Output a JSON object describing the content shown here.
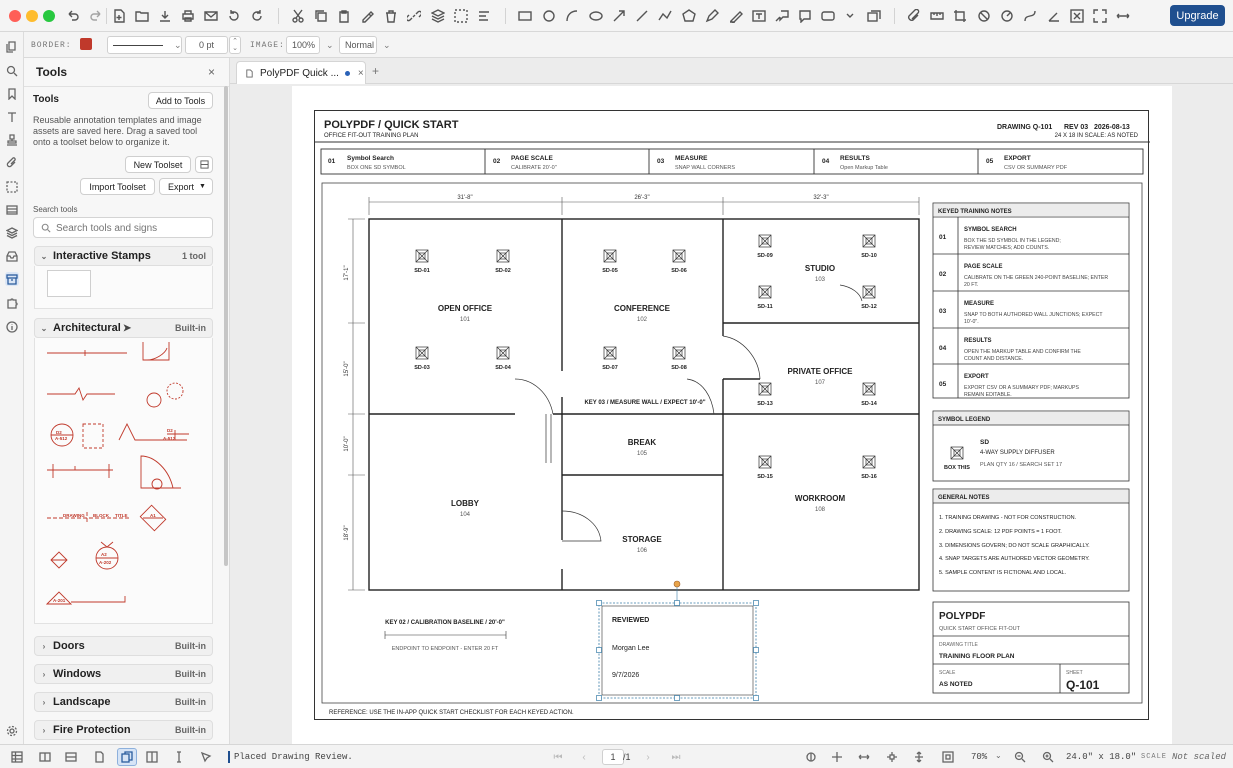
{
  "toolbar": {
    "upgrade": "Upgrade"
  },
  "props": {
    "border_label": "BORDER:",
    "border_color": "#c0392b",
    "width_value": "0 pt",
    "image_label": "IMAGE:",
    "image_zoom": "100%",
    "blend": "Normal"
  },
  "panel": {
    "header": "Tools",
    "close": "×",
    "section_title": "Tools",
    "add_to_tools": "Add to Tools",
    "description": "Reusable annotation templates and image assets are saved here. Drag a saved tool onto a toolset below to organize it.",
    "new_toolset": "New Toolset",
    "import_toolset": "Import Toolset",
    "export": "Export",
    "search_label": "Search tools",
    "search_placeholder": "Search tools and signs",
    "sections": [
      {
        "name": "Interactive Stamps",
        "tag": "1 tool"
      },
      {
        "name": "Architectural",
        "tag": "Built-in"
      },
      {
        "name": "Doors",
        "tag": "Built-in"
      },
      {
        "name": "Windows",
        "tag": "Built-in"
      },
      {
        "name": "Landscape",
        "tag": "Built-in"
      },
      {
        "name": "Fire Protection",
        "tag": "Built-in"
      }
    ],
    "arch_labels": {
      "a": "A-512",
      "b": "D2",
      "c": "A-512",
      "d": "D2",
      "e": "DRAWING",
      "f": "BLOCK",
      "g": "TITLE",
      "h": "A1",
      "i": "A-201",
      "j": "A2",
      "k": "A-202",
      "l": "A-201"
    }
  },
  "tabs": {
    "doc": "PolyPDF Quick ...",
    "add": "+"
  },
  "drawing": {
    "title": "POLYPDF / QUICK START",
    "subtitle": "OFFICE FIT-OUT TRAINING PLAN",
    "drawing_no": "DRAWING Q-101",
    "rev": "REV 03",
    "date": "2026-08-13",
    "size_scale": "24 X 18 IN    SCALE: AS NOTED",
    "steps": [
      {
        "num": "01",
        "title": "Symbol Search",
        "sub": "BOX ONE SD SYMBOL"
      },
      {
        "num": "02",
        "title": "PAGE SCALE",
        "sub": "CALIBRATE 20'-0\""
      },
      {
        "num": "03",
        "title": "MEASURE",
        "sub": "SNAP WALL CORNERS"
      },
      {
        "num": "04",
        "title": "RESULTS",
        "sub": "Open Markup Table"
      },
      {
        "num": "05",
        "title": "EXPORT",
        "sub": "CSV OR SUMMARY PDF"
      }
    ],
    "dims": {
      "d1": "31'-8\"",
      "d2": "26'-3\"",
      "d3": "32'-3\"",
      "v1": "17'-1\"",
      "v2": "15'-0\"",
      "v3": "10'-0\"",
      "v4": "18'-9\""
    },
    "rooms": [
      {
        "name": "OPEN OFFICE",
        "num": "101"
      },
      {
        "name": "CONFERENCE",
        "num": "102"
      },
      {
        "name": "STUDIO",
        "num": "103"
      },
      {
        "name": "LOBBY",
        "num": "104"
      },
      {
        "name": "BREAK",
        "num": "105"
      },
      {
        "name": "STORAGE",
        "num": "106"
      },
      {
        "name": "PRIVATE OFFICE",
        "num": "107"
      },
      {
        "name": "WORKROOM",
        "num": "108"
      }
    ],
    "sd": [
      "SD-01",
      "SD-02",
      "SD-03",
      "SD-04",
      "SD-05",
      "SD-06",
      "SD-07",
      "SD-08",
      "SD-09",
      "SD-10",
      "SD-11",
      "SD-12",
      "SD-13",
      "SD-14",
      "SD-15",
      "SD-16"
    ],
    "key03": "KEY 03 / MEASURE WALL / EXPECT 10'-0\"",
    "key02": "KEY 02 / CALIBRATION BASELINE / 20'-0\"",
    "key02_sub": "ENDPOINT TO ENDPOINT - ENTER 20 FT",
    "review": {
      "title": "REVIEWED",
      "name": "Morgan Lee",
      "date": "9/7/2026"
    },
    "notes_title": "KEYED TRAINING NOTES",
    "notes": [
      {
        "num": "01",
        "title": "SYMBOL SEARCH",
        "text1": "BOX THE SD SYMBOL IN THE LEGEND;",
        "text2": "REVIEW MATCHES; ADD COUNTS."
      },
      {
        "num": "02",
        "title": "PAGE SCALE",
        "text1": "CALIBRATE ON THE GREEN 240-POINT BASELINE; ENTER",
        "text2": "20 FT."
      },
      {
        "num": "03",
        "title": "MEASURE",
        "text1": "SNAP TO BOTH AUTHORED WALL JUNCTIONS; EXPECT",
        "text2": "10'-0\"."
      },
      {
        "num": "04",
        "title": "RESULTS",
        "text1": "OPEN THE MARKUP TABLE AND CONFIRM THE",
        "text2": "COUNT AND DISTANCE."
      },
      {
        "num": "05",
        "title": "EXPORT",
        "text1": "EXPORT CSV OR A SUMMARY PDF; MARKUPS",
        "text2": "REMAIN EDITABLE."
      }
    ],
    "legend": {
      "title": "SYMBOL LEGEND",
      "box": "BOX THIS",
      "code": "SD",
      "name": "4-WAY SUPPLY DIFFUSER",
      "qty": "PLAN QTY 16 / SEARCH SET 17"
    },
    "general_title": "GENERAL NOTES",
    "general": [
      "1. TRAINING DRAWING - NOT FOR CONSTRUCTION.",
      "2. DRAWING SCALE: 12 PDF POINTS = 1 FOOT.",
      "3. DIMENSIONS GOVERN; DO NOT SCALE GRAPHICALLY.",
      "4. SNAP TARGETS ARE AUTHORED VECTOR GEOMETRY.",
      "5. SAMPLE CONTENT IS FICTIONAL AND LOCAL."
    ],
    "tb": {
      "brand": "POLYPDF",
      "brand_sub": "QUICK START OFFICE FIT-OUT",
      "dt_label": "DRAWING TITLE",
      "dt": "TRAINING FLOOR PLAN",
      "scale_label": "SCALE",
      "scale": "AS NOTED",
      "sheet_label": "SHEET",
      "sheet": "Q-101"
    },
    "reference": "REFERENCE: USE THE IN-APP QUICK START CHECKLIST FOR EACH KEYED ACTION."
  },
  "status": {
    "message": "Placed Drawing Review.",
    "page": "1",
    "of": "/1",
    "zoom": "70%",
    "size": "24.0\" x 18.0\"",
    "scale_label": "SCALE",
    "scale_value": "Not scaled"
  },
  "colors": {
    "accent": "#1f4f8f",
    "mark": "#c0392b",
    "wall": "#222222"
  }
}
